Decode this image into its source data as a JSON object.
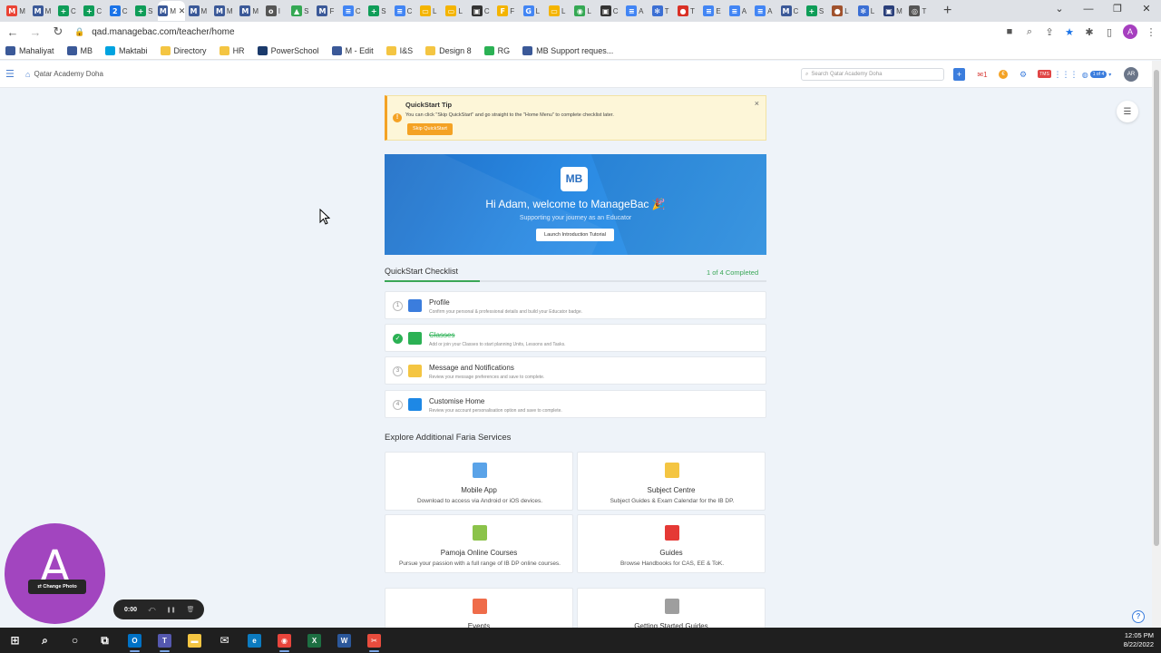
{
  "browser": {
    "tabs": [
      {
        "icon": "gmail-icon",
        "color": "#ea4335",
        "glyph": "M",
        "label": "M"
      },
      {
        "icon": "managebac-icon",
        "color": "#3b5998",
        "glyph": "M",
        "label": "M"
      },
      {
        "icon": "sheets-icon",
        "color": "#0f9d58",
        "glyph": "+",
        "label": "C"
      },
      {
        "icon": "sheets-icon",
        "color": "#0f9d58",
        "glyph": "+",
        "label": "C"
      },
      {
        "icon": "calendar-icon",
        "color": "#1a73e8",
        "glyph": "2",
        "label": "C"
      },
      {
        "icon": "sheets-icon",
        "color": "#0f9d58",
        "glyph": "+",
        "label": "S"
      },
      {
        "icon": "managebac-icon",
        "color": "#3b5998",
        "glyph": "M",
        "label": "M"
      },
      {
        "icon": "managebac-icon",
        "color": "#3b5998",
        "glyph": "M",
        "label": "M"
      },
      {
        "icon": "managebac-icon",
        "color": "#3b5998",
        "glyph": "M",
        "label": "M"
      },
      {
        "icon": "managebac-icon",
        "color": "#3b5998",
        "glyph": "M",
        "label": "M"
      },
      {
        "icon": "github-icon",
        "color": "#555555",
        "glyph": "o",
        "label": "I"
      },
      {
        "icon": "drive-icon",
        "color": "#34a853",
        "glyph": "▲",
        "label": "S"
      },
      {
        "icon": "managebac-icon",
        "color": "#3b5998",
        "glyph": "M",
        "label": "F"
      },
      {
        "icon": "docs-icon",
        "color": "#4285f4",
        "glyph": "≡",
        "label": "C"
      },
      {
        "icon": "sheets-icon",
        "color": "#0f9d58",
        "glyph": "+",
        "label": "S"
      },
      {
        "icon": "docs-icon",
        "color": "#4285f4",
        "glyph": "≡",
        "label": "C"
      },
      {
        "icon": "slides-icon",
        "color": "#f4b400",
        "glyph": "▭",
        "label": "L"
      },
      {
        "icon": "slides-icon",
        "color": "#f4b400",
        "glyph": "▭",
        "label": "L"
      },
      {
        "icon": "classroom-icon",
        "color": "#333333",
        "glyph": "▣",
        "label": "C"
      },
      {
        "icon": "jamboard-icon",
        "color": "#f4b400",
        "glyph": "F",
        "label": "F"
      },
      {
        "icon": "google-icon",
        "color": "#4285f4",
        "glyph": "G",
        "label": "L"
      },
      {
        "icon": "slides-icon",
        "color": "#f4b400",
        "glyph": "▭",
        "label": "L"
      },
      {
        "icon": "maps-icon",
        "color": "#34a853",
        "glyph": "◉",
        "label": "L"
      },
      {
        "icon": "classroom-icon",
        "color": "#333333",
        "glyph": "▣",
        "label": "C"
      },
      {
        "icon": "docs-icon",
        "color": "#4285f4",
        "glyph": "≡",
        "label": "A"
      },
      {
        "icon": "gear-icon",
        "color": "#3b6fd4",
        "glyph": "✻",
        "label": "T"
      },
      {
        "icon": "red-icon",
        "color": "#d93025",
        "glyph": "●",
        "label": "T"
      },
      {
        "icon": "docs-icon",
        "color": "#4285f4",
        "glyph": "≡",
        "label": "E"
      },
      {
        "icon": "docs-icon",
        "color": "#4285f4",
        "glyph": "≡",
        "label": "A"
      },
      {
        "icon": "docs-icon",
        "color": "#4285f4",
        "glyph": "≡",
        "label": "A"
      },
      {
        "icon": "managebac-icon",
        "color": "#3b5998",
        "glyph": "M",
        "label": "C"
      },
      {
        "icon": "sheets-icon",
        "color": "#0f9d58",
        "glyph": "+",
        "label": "S"
      },
      {
        "icon": "profile-icon",
        "color": "#a0522d",
        "glyph": "●",
        "label": "L"
      },
      {
        "icon": "gear-icon",
        "color": "#3b6fd4",
        "glyph": "✻",
        "label": "L"
      },
      {
        "icon": "managebac-icon",
        "color": "#2a3f7a",
        "glyph": "▣",
        "label": "M"
      },
      {
        "icon": "chrome-icon",
        "color": "#555555",
        "glyph": "◎",
        "label": "T"
      }
    ],
    "active_tab_index": 6,
    "active_tab_close": "✕",
    "new_tab": "+",
    "window": {
      "minimize": "⌄",
      "restore": "—",
      "maximize": "❐",
      "close": "✕"
    },
    "url": "qad.managebac.com/teacher/home",
    "avatar_letter": "A",
    "bookmarks": [
      {
        "label": "Mahaliyat",
        "color": "#3b5998"
      },
      {
        "label": "MB",
        "color": "#3b5998"
      },
      {
        "label": "Maktabi",
        "color": "#00a3e0"
      },
      {
        "label": "Directory",
        "color": "#f4c542"
      },
      {
        "label": "HR",
        "color": "#f4c542"
      },
      {
        "label": "PowerSchool",
        "color": "#1b3a6b"
      },
      {
        "label": "M - Edit",
        "color": "#3b5998"
      },
      {
        "label": "I&S",
        "color": "#f4c542"
      },
      {
        "label": "Design 8",
        "color": "#f4c542"
      },
      {
        "label": "RG",
        "color": "#2bb154"
      },
      {
        "label": "MB Support reques...",
        "color": "#3b5998"
      }
    ]
  },
  "header": {
    "school": "Qatar Academy Doha",
    "search_placeholder": "Search Qatar Academy Doha",
    "plus": "+",
    "mail_count": "1",
    "orange_glyph": "€",
    "badge_text": "TMS",
    "globe_pill": "1 of 4",
    "user_initials": "AR"
  },
  "tip": {
    "title": "QuickStart Tip",
    "body": "You can click \"Skip QuickStart\" and go straight to the \"Home Menu\" to complete checklist later.",
    "button": "Skip QuickStart",
    "close": "×"
  },
  "banner": {
    "logo": "MB",
    "welcome": "Hi Adam, welcome to ManageBac 🎉",
    "subtitle": "Supporting your journey as an Educator",
    "button": "Launch Introduction Tutorial"
  },
  "checklist": {
    "title": "QuickStart Checklist",
    "status": "1 of 4 Completed",
    "progress": 0.25,
    "items": [
      {
        "num": "1",
        "done": false,
        "title": "Profile",
        "desc": "Confirm your personal & professional details and build your Educator badge.",
        "color": "#3b7ddd"
      },
      {
        "num": "2",
        "done": true,
        "title": "Classes",
        "desc": "Add or join your Classes to start planning Units, Lessons and Tasks.",
        "color": "#2bb154"
      },
      {
        "num": "3",
        "done": false,
        "title": "Message and Notifications",
        "desc": "Review your message preferences and save to complete.",
        "color": "#f4c542"
      },
      {
        "num": "4",
        "done": false,
        "title": "Customise Home",
        "desc": "Review your account personalisation option and save to complete.",
        "color": "#1e88e5"
      }
    ]
  },
  "services": {
    "title": "Explore Additional Faria Services",
    "items": [
      {
        "title": "Mobile App",
        "desc": "Download to access via Android or iOS devices.",
        "color": "#5aa3e8"
      },
      {
        "title": "Subject Centre",
        "desc": "Subject Guides & Exam Calendar for the IB DP.",
        "color": "#f4c542"
      },
      {
        "title": "Pamoja Online Courses",
        "desc": "Pursue your passion with a full range of IB DP online courses.",
        "color": "#8bc34a"
      },
      {
        "title": "Guides",
        "desc": "Browse Handbooks for CAS, EE & ToK.",
        "color": "#e53935"
      },
      {
        "title": "Events",
        "desc": "",
        "color": "#ef6c4a"
      },
      {
        "title": "Getting Started Guides",
        "desc": "",
        "color": "#9e9e9e"
      }
    ]
  },
  "webcam": {
    "letter": "A",
    "button": "Change Photo"
  },
  "recorder": {
    "time": "0:00",
    "undo": "⤺",
    "pause": "❚❚",
    "delete": "🗑"
  },
  "help": "?",
  "taskbar": {
    "apps": [
      {
        "icon": "windows-start-icon",
        "color": "#ffffff",
        "glyph": "⊞",
        "run": false
      },
      {
        "icon": "search-icon",
        "color": "#ffffff",
        "glyph": "⌕",
        "run": false
      },
      {
        "icon": "cortana-icon",
        "color": "#ffffff",
        "glyph": "○",
        "run": false
      },
      {
        "icon": "task-view-icon",
        "color": "#ffffff",
        "glyph": "⧉",
        "run": false
      },
      {
        "icon": "outlook-icon",
        "color": "#0072c6",
        "glyph": "O",
        "run": true
      },
      {
        "icon": "teams-icon",
        "color": "#5558af",
        "glyph": "T",
        "run": true
      },
      {
        "icon": "file-explorer-icon",
        "color": "#f4c542",
        "glyph": "▬",
        "run": false
      },
      {
        "icon": "mail-icon",
        "color": "#ffffff",
        "glyph": "✉",
        "run": false
      },
      {
        "icon": "edge-icon",
        "color": "#0c7bc0",
        "glyph": "e",
        "run": false
      },
      {
        "icon": "chrome-icon",
        "color": "#e8453c",
        "glyph": "◉",
        "run": true
      },
      {
        "icon": "excel-icon",
        "color": "#1d6f42",
        "glyph": "X",
        "run": false
      },
      {
        "icon": "word-icon",
        "color": "#2b579a",
        "glyph": "W",
        "run": false
      },
      {
        "icon": "snip-icon",
        "color": "#e84c3d",
        "glyph": "✂",
        "run": true
      }
    ],
    "time": "12:05 PM",
    "date": "8/22/2022"
  }
}
